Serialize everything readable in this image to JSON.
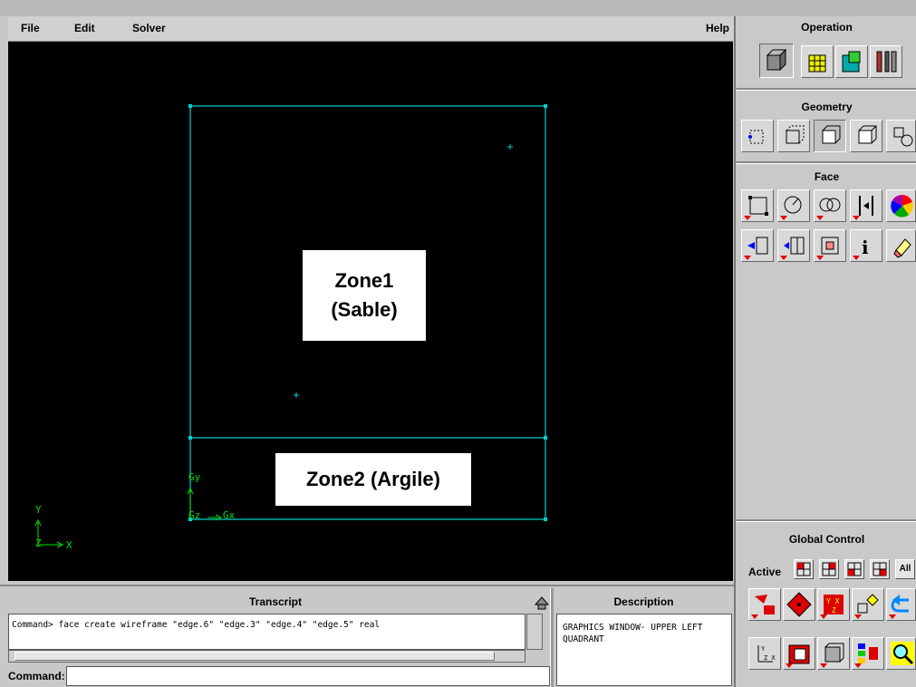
{
  "menubar": {
    "file": "File",
    "edit": "Edit",
    "solver": "Solver",
    "help": "Help"
  },
  "graphics": {
    "zone1_line1": "Zone1",
    "zone1_line2": "(Sable)",
    "zone2": "Zone2 (Argile)",
    "axis_y": "Y",
    "axis_x": "X",
    "axis_z": "Z",
    "local_gy": "Gy",
    "local_gz": "Gz",
    "local_gx": "Gx",
    "wire_color": "#00d0d0",
    "axis_color": "#00e000"
  },
  "panel": {
    "operation_title": "Operation",
    "geometry_title": "Geometry",
    "face_title": "Face",
    "global_control_title": "Global Control",
    "active_label": "Active",
    "all_label": "All"
  },
  "operation_icons": [
    "mesh-icon",
    "geometry-icon",
    "zones-icon",
    "tools-icon"
  ],
  "geometry_icons": [
    "vertex-icon",
    "edge-icon",
    "face-icon",
    "volume-icon",
    "group-icon"
  ],
  "face_icons_row1": [
    "form-face-icon",
    "circle-face-icon",
    "boolean-face-icon",
    "move-face-icon",
    "color-face-icon"
  ],
  "face_icons_row2": [
    "connect-face-icon",
    "split-face-icon",
    "summarize-face-icon",
    "info-face-icon",
    "delete-face-icon"
  ],
  "transcript": {
    "title": "Transcript",
    "text": "Command> face create wireframe \"edge.6\" \"edge.3\" \"edge.4\" \"edge.5\" real"
  },
  "command": {
    "label": "Command:"
  },
  "description": {
    "title": "Description",
    "text": "GRAPHICS WINDOW- UPPER LEFT QUADRANT"
  }
}
